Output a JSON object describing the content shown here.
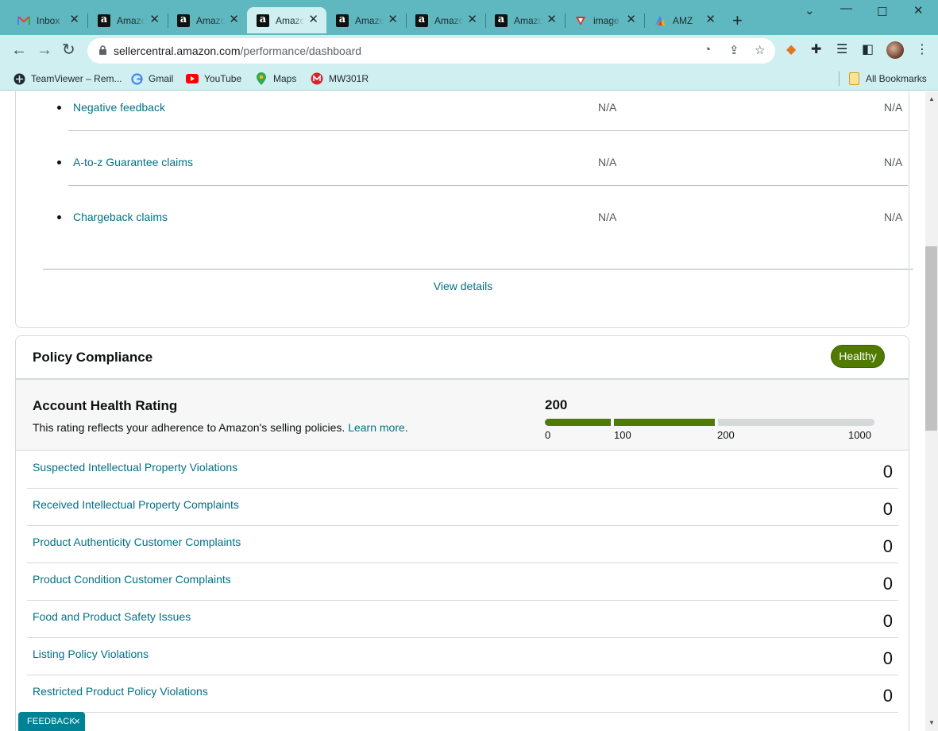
{
  "browser": {
    "tabs": [
      {
        "title": "Inbox",
        "icon": "gmail-icon"
      },
      {
        "title": "Amazon",
        "icon": "amazon-icon"
      },
      {
        "title": "Amazon",
        "icon": "amazon-icon"
      },
      {
        "title": "Amazon",
        "icon": "amazon-icon",
        "active": true
      },
      {
        "title": "Amazon",
        "icon": "amazon-icon"
      },
      {
        "title": "Amazon",
        "icon": "amazon-icon"
      },
      {
        "title": "Amazon",
        "icon": "amazon-icon"
      },
      {
        "title": "image",
        "icon": "vivaldi-icon"
      },
      {
        "title": "AMZ",
        "icon": "amz-icon"
      }
    ],
    "url_host": "sellercentral.amazon.com",
    "url_path": "/performance/dashboard",
    "bookmarks": [
      {
        "label": "TeamViewer – Rem...",
        "icon": "teamviewer-icon"
      },
      {
        "label": "Gmail",
        "icon": "google-icon"
      },
      {
        "label": "YouTube",
        "icon": "youtube-icon"
      },
      {
        "label": "Maps",
        "icon": "maps-icon"
      },
      {
        "label": "MW301R",
        "icon": "mw-icon"
      }
    ],
    "all_bookmarks": "All Bookmarks",
    "accent": "#5fb7bf"
  },
  "metrics": [
    {
      "name": "Negative feedback",
      "value1": "N/A",
      "value2": "N/A"
    },
    {
      "name": "A-to-z Guarantee claims",
      "value1": "N/A",
      "value2": "N/A"
    },
    {
      "name": "Chargeback claims",
      "value1": "N/A",
      "value2": "N/A"
    }
  ],
  "view_details": "View details",
  "policy": {
    "title": "Policy Compliance",
    "status": "Healthy",
    "status_color": "#507b00",
    "ahr": {
      "title": "Account Health Rating",
      "description": "This rating reflects your adherence to Amazon's selling policies.",
      "learn_more": "Learn more",
      "period": ".",
      "score": "200",
      "ticks": [
        "0",
        "100",
        "200",
        "1000"
      ]
    },
    "violations": [
      {
        "label": "Suspected Intellectual Property Violations",
        "count": "0"
      },
      {
        "label": "Received Intellectual Property Complaints",
        "count": "0"
      },
      {
        "label": "Product Authenticity Customer Complaints",
        "count": "0"
      },
      {
        "label": "Product Condition Customer Complaints",
        "count": "0"
      },
      {
        "label": "Food and Product Safety Issues",
        "count": "0"
      },
      {
        "label": "Listing Policy Violations",
        "count": "0"
      },
      {
        "label": "Restricted Product Policy Violations",
        "count": "0"
      }
    ]
  },
  "feedback": {
    "label": "FEEDBACK",
    "close": "×"
  }
}
